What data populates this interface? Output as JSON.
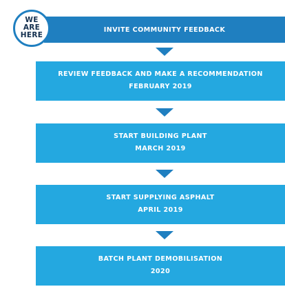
{
  "badge": {
    "line1": "WE",
    "line2": "ARE",
    "line3": "HERE"
  },
  "steps": [
    {
      "line1": "INVITE COMMUNITY FEEDBACK"
    },
    {
      "line1": "REVIEW FEEDBACK AND MAKE A RECOMMENDATION",
      "line2": "FEBRUARY 2019"
    },
    {
      "line1": "START BUILDING PLANT",
      "line2": "MARCH 2019"
    },
    {
      "line1": "START SUPPLYING ASPHALT",
      "line2": "APRIL 2019"
    },
    {
      "line1": "BATCH PLANT DEMOBILISATION",
      "line2": "2020"
    }
  ],
  "colors": {
    "current_step": "#1f7fc0",
    "future_step": "#24a8e0",
    "arrow": "#1f7fc0",
    "badge_text": "#14304f"
  }
}
